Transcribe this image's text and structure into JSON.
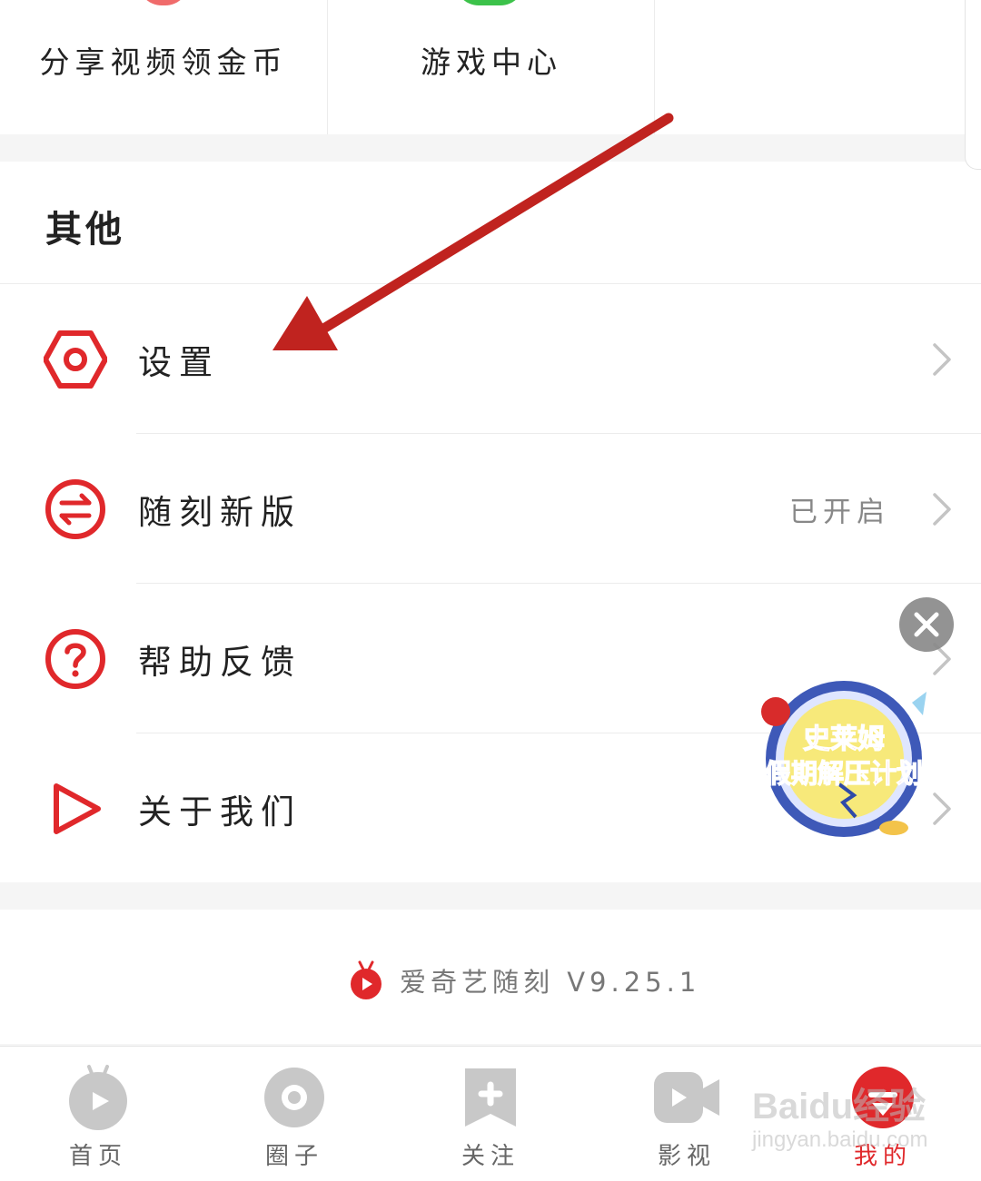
{
  "top_grid": {
    "items": [
      {
        "label": "分享视频领金币"
      },
      {
        "label": "游戏中心"
      },
      {
        "label": ""
      }
    ]
  },
  "other_section": {
    "title": "其他",
    "items": [
      {
        "label": "设置",
        "icon": "hexagon-settings-icon",
        "value": ""
      },
      {
        "label": "随刻新版",
        "icon": "switch-arrows-icon",
        "value": "已开启"
      },
      {
        "label": "帮助反馈",
        "icon": "question-circle-icon",
        "value": ""
      },
      {
        "label": "关于我们",
        "icon": "play-triangle-icon",
        "value": ""
      }
    ]
  },
  "version": {
    "text": "爱奇艺随刻 V9.25.1",
    "icon": "iqiyi-suike-logo-icon"
  },
  "floating_promo": {
    "text_line1": "史莱姆",
    "text_line2": "假期解压计划",
    "close_icon": "close-icon"
  },
  "tabbar": {
    "tabs": [
      {
        "label": "首页",
        "icon": "home-tv-icon",
        "active": false
      },
      {
        "label": "圈子",
        "icon": "circle-icon",
        "active": false
      },
      {
        "label": "关注",
        "icon": "follow-plus-icon",
        "active": false
      },
      {
        "label": "影视",
        "icon": "video-camera-icon",
        "active": false
      },
      {
        "label": "我的",
        "icon": "profile-icon",
        "active": true
      }
    ]
  },
  "watermark": {
    "main": "Baidu经验",
    "sub": "jingyan.baidu.com"
  },
  "colors": {
    "accent": "#e0282b",
    "icon_gray": "#c8c8c8",
    "divider": "#ececec"
  }
}
